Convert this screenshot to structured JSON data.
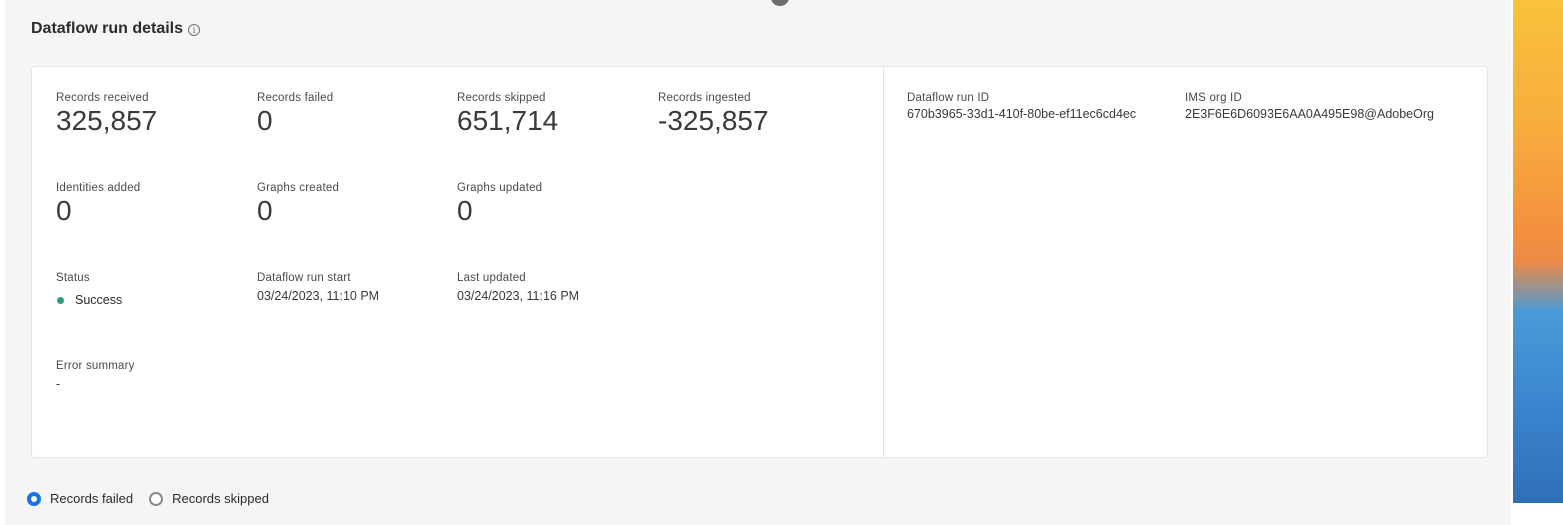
{
  "header": {
    "title": "Dataflow run details",
    "info_icon": "info-icon"
  },
  "metrics": {
    "records_received": {
      "label": "Records received",
      "value": "325,857"
    },
    "records_failed": {
      "label": "Records failed",
      "value": "0"
    },
    "records_skipped": {
      "label": "Records skipped",
      "value": "651,714"
    },
    "records_ingested": {
      "label": "Records ingested",
      "value": "-325,857"
    },
    "identities_added": {
      "label": "Identities added",
      "value": "0"
    },
    "graphs_created": {
      "label": "Graphs created",
      "value": "0"
    },
    "graphs_updated": {
      "label": "Graphs updated",
      "value": "0"
    }
  },
  "status": {
    "label": "Status",
    "value": "Success",
    "color": "#2d9d78"
  },
  "run_start": {
    "label": "Dataflow run start",
    "value": "03/24/2023, 11:10 PM"
  },
  "last_updated": {
    "label": "Last updated",
    "value": "03/24/2023, 11:16 PM"
  },
  "error_summary": {
    "label": "Error summary",
    "value": "-"
  },
  "run_id": {
    "label": "Dataflow run ID",
    "value": "670b3965-33d1-410f-80be-ef11ec6cd4ec"
  },
  "ims_org": {
    "label": "IMS org ID",
    "value": "2E3F6E6D6093E6AA0A495E98@AdobeOrg"
  },
  "filter": {
    "options": [
      {
        "label": "Records failed",
        "selected": true
      },
      {
        "label": "Records skipped",
        "selected": false
      }
    ]
  },
  "colors": {
    "accent": "#1473e6",
    "success": "#2d9d78"
  }
}
